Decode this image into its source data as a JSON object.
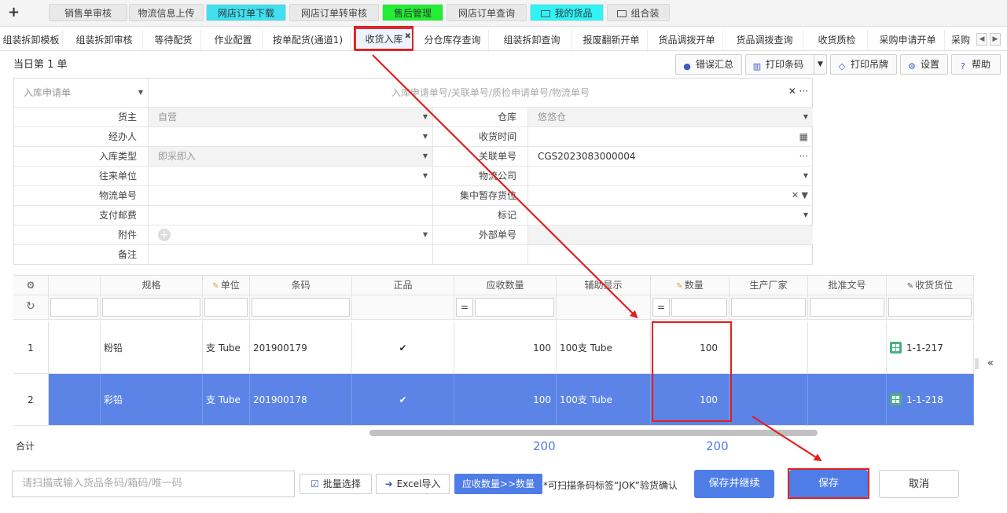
{
  "top_tabs": [
    {
      "label": "销售单审核",
      "style": "gray"
    },
    {
      "label": "物流信息上传",
      "style": "gray"
    },
    {
      "label": "网店订单下载",
      "style": "cyan"
    },
    {
      "label": "网店订单转审核",
      "style": "gray"
    },
    {
      "label": "售后管理",
      "style": "green"
    },
    {
      "label": "网店订单查询",
      "style": "gray"
    },
    {
      "label": "我的货品",
      "style": "cyan2",
      "icon": "folder-icon"
    },
    {
      "label": "组合装",
      "style": "gray",
      "icon": "folder-icon"
    }
  ],
  "sub_tabs": [
    {
      "label": "组装拆卸模板"
    },
    {
      "label": "组装拆卸审核"
    },
    {
      "label": "等待配货"
    },
    {
      "label": "作业配置"
    },
    {
      "label": "按单配货(通道1)"
    },
    {
      "label": "收货入库",
      "active": true
    },
    {
      "label": "分仓库存查询"
    },
    {
      "label": "组装拆卸查询"
    },
    {
      "label": "报废翻新开单"
    },
    {
      "label": "货品调拨开单"
    },
    {
      "label": "货品调拨查询"
    },
    {
      "label": "收货质检"
    },
    {
      "label": "采购申请开单"
    },
    {
      "label": "采购"
    }
  ],
  "summary": "当日第 1 单",
  "toolbar": {
    "error_summary": "错误汇总",
    "print_barcode": "打印条码",
    "print_tag": "打印吊牌",
    "settings": "设置",
    "help": "帮助"
  },
  "form": {
    "request_type": "入库申请单",
    "search_placeholder": "入库申请单号/关联单号/质检申请单号/物流单号",
    "labels": {
      "owner": "货主",
      "handler": "经办人",
      "inbound_type": "入库类型",
      "partner": "往来单位",
      "logistics_no": "物流单号",
      "postage": "支付邮费",
      "attachment": "附件",
      "remark": "备注",
      "warehouse": "仓库",
      "receive_time": "收货时间",
      "related_no": "关联单号",
      "logistics_company": "物流公司",
      "temp_location": "集中暂存货位",
      "mark": "标记",
      "external_no": "外部单号"
    },
    "values": {
      "owner": "自营",
      "inbound_type": "即采即入",
      "warehouse": "悠悠仓",
      "related_no": "CGS2023083000004"
    }
  },
  "grid": {
    "headers": [
      "规格",
      "单位",
      "条码",
      "正品",
      "应收数量",
      "辅助显示",
      "数量",
      "生产厂家",
      "批准文号",
      "收货货位"
    ],
    "rows": [
      {
        "no": "1",
        "spec": "粉铅",
        "unit": "支 Tube",
        "barcode": "201900179",
        "genuine": "✔",
        "expected_qty": "100",
        "aux": "100支 Tube",
        "qty": "100",
        "maker": "",
        "approval": "",
        "location": "1-1-217"
      },
      {
        "no": "2",
        "spec": "彩铅",
        "unit": "支 Tube",
        "barcode": "201900178",
        "genuine": "✔",
        "expected_qty": "100",
        "aux": "100支 Tube",
        "qty": "100",
        "maker": "",
        "approval": "",
        "location": "1-1-218"
      }
    ],
    "total_label": "合计",
    "total_expected": "200",
    "total_qty": "200",
    "eq_symbol": "="
  },
  "bottom": {
    "scan_placeholder": "请扫描或输入货品条码/箱码/唯一码",
    "batch_select": "批量选择",
    "excel_import": "Excel导入",
    "copy_qty": "应收数量>>数量",
    "hint": "*可扫描条码标签“JOK”验货确认",
    "save_continue": "保存并继续",
    "save": "保存",
    "cancel": "取消"
  },
  "colors": {
    "accent": "#4f7de8",
    "selected_row": "#5b84e6",
    "highlight": "#e02020"
  }
}
